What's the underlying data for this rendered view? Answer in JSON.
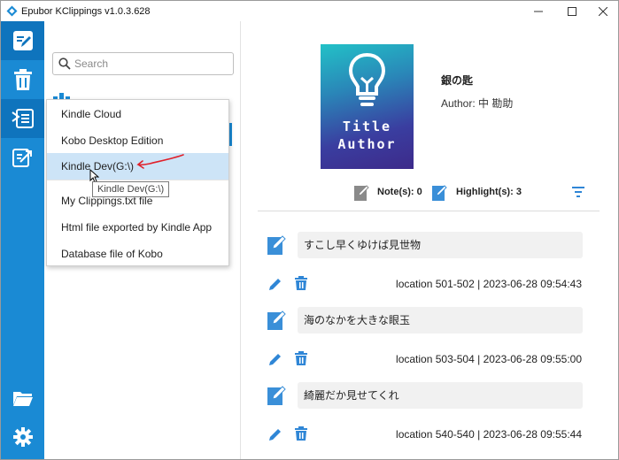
{
  "window": {
    "title": "Epubor KClippings v1.0.3.628"
  },
  "rail": {
    "items": [
      {
        "name": "edit-notes-icon",
        "active": true
      },
      {
        "name": "trash-icon",
        "active": false
      },
      {
        "name": "import-icon",
        "active": true
      },
      {
        "name": "export-icon",
        "active": false
      }
    ],
    "bottom": [
      {
        "name": "folder-icon"
      },
      {
        "name": "gear-icon"
      }
    ]
  },
  "search": {
    "placeholder": "Search"
  },
  "menu": {
    "items": [
      {
        "label": "Kindle Cloud"
      },
      {
        "label": "Kobo Desktop Edition"
      },
      {
        "label": "Kindle Dev(G:\\)"
      },
      {
        "label": "My Clippings.txt file"
      },
      {
        "label": "Html file exported by Kindle App"
      },
      {
        "label": "Database file of Kobo"
      }
    ],
    "tooltip": "Kindle Dev(G:\\)"
  },
  "book": {
    "cover_title": "Title",
    "cover_author": "Author",
    "title": "銀の匙",
    "author": "Author: 中 勘助"
  },
  "stats": {
    "notes": "Note(s): 0",
    "highlights": "Highlight(s): 3"
  },
  "entries": [
    {
      "text": "すこし早くゆけば見世物",
      "meta": "location 501-502 | 2023-06-28 09:54:43"
    },
    {
      "text": "海のなかを大きな眼玉",
      "meta": "location 503-504 | 2023-06-28 09:55:00"
    },
    {
      "text": "綺麗だか見せてくれ",
      "meta": "location 540-540 | 2023-06-28 09:55:44"
    }
  ],
  "colors": {
    "accent": "#1a8ad4",
    "accent_dark": "#0f74bd",
    "menu_highlight": "#cde4f7",
    "annotation_red": "#e0202a"
  }
}
